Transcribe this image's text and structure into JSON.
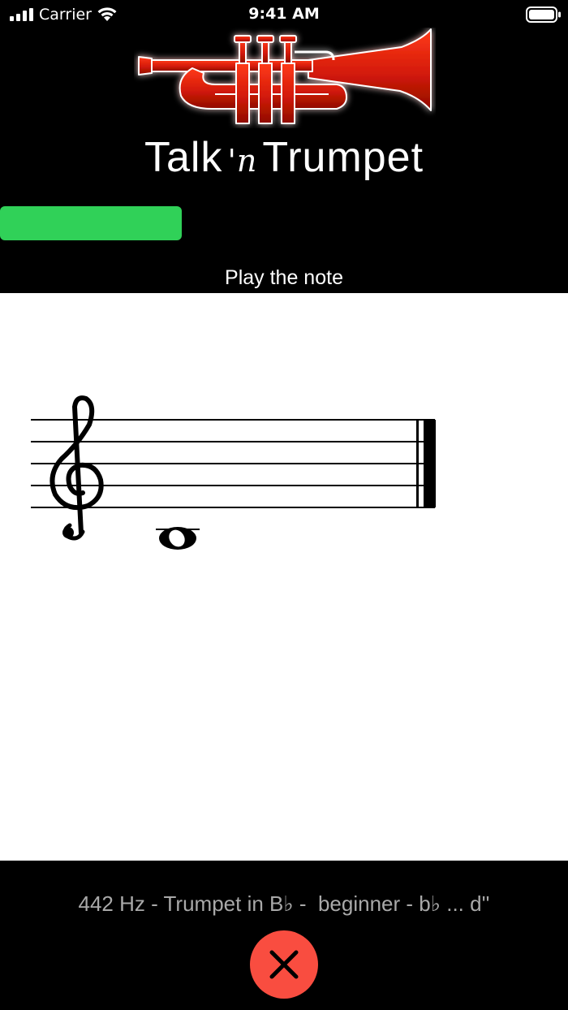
{
  "status_bar": {
    "carrier": "Carrier",
    "time": "9:41 AM"
  },
  "header": {
    "app_name_before": "Talk",
    "app_name_middle": "'n",
    "app_name_after": "Trumpet",
    "progress_fraction": 0.32,
    "progress_color": "#30d158",
    "instruction": "Play the note"
  },
  "staff": {
    "clef": "treble",
    "note": "whole note on the first ledger line below the staff",
    "barline": "final"
  },
  "footer": {
    "settings_summary": "442 Hz - Trumpet in B♭ -  beginner - b♭ ... d''",
    "close_icon": "close-icon",
    "close_color": "#f94d40"
  }
}
